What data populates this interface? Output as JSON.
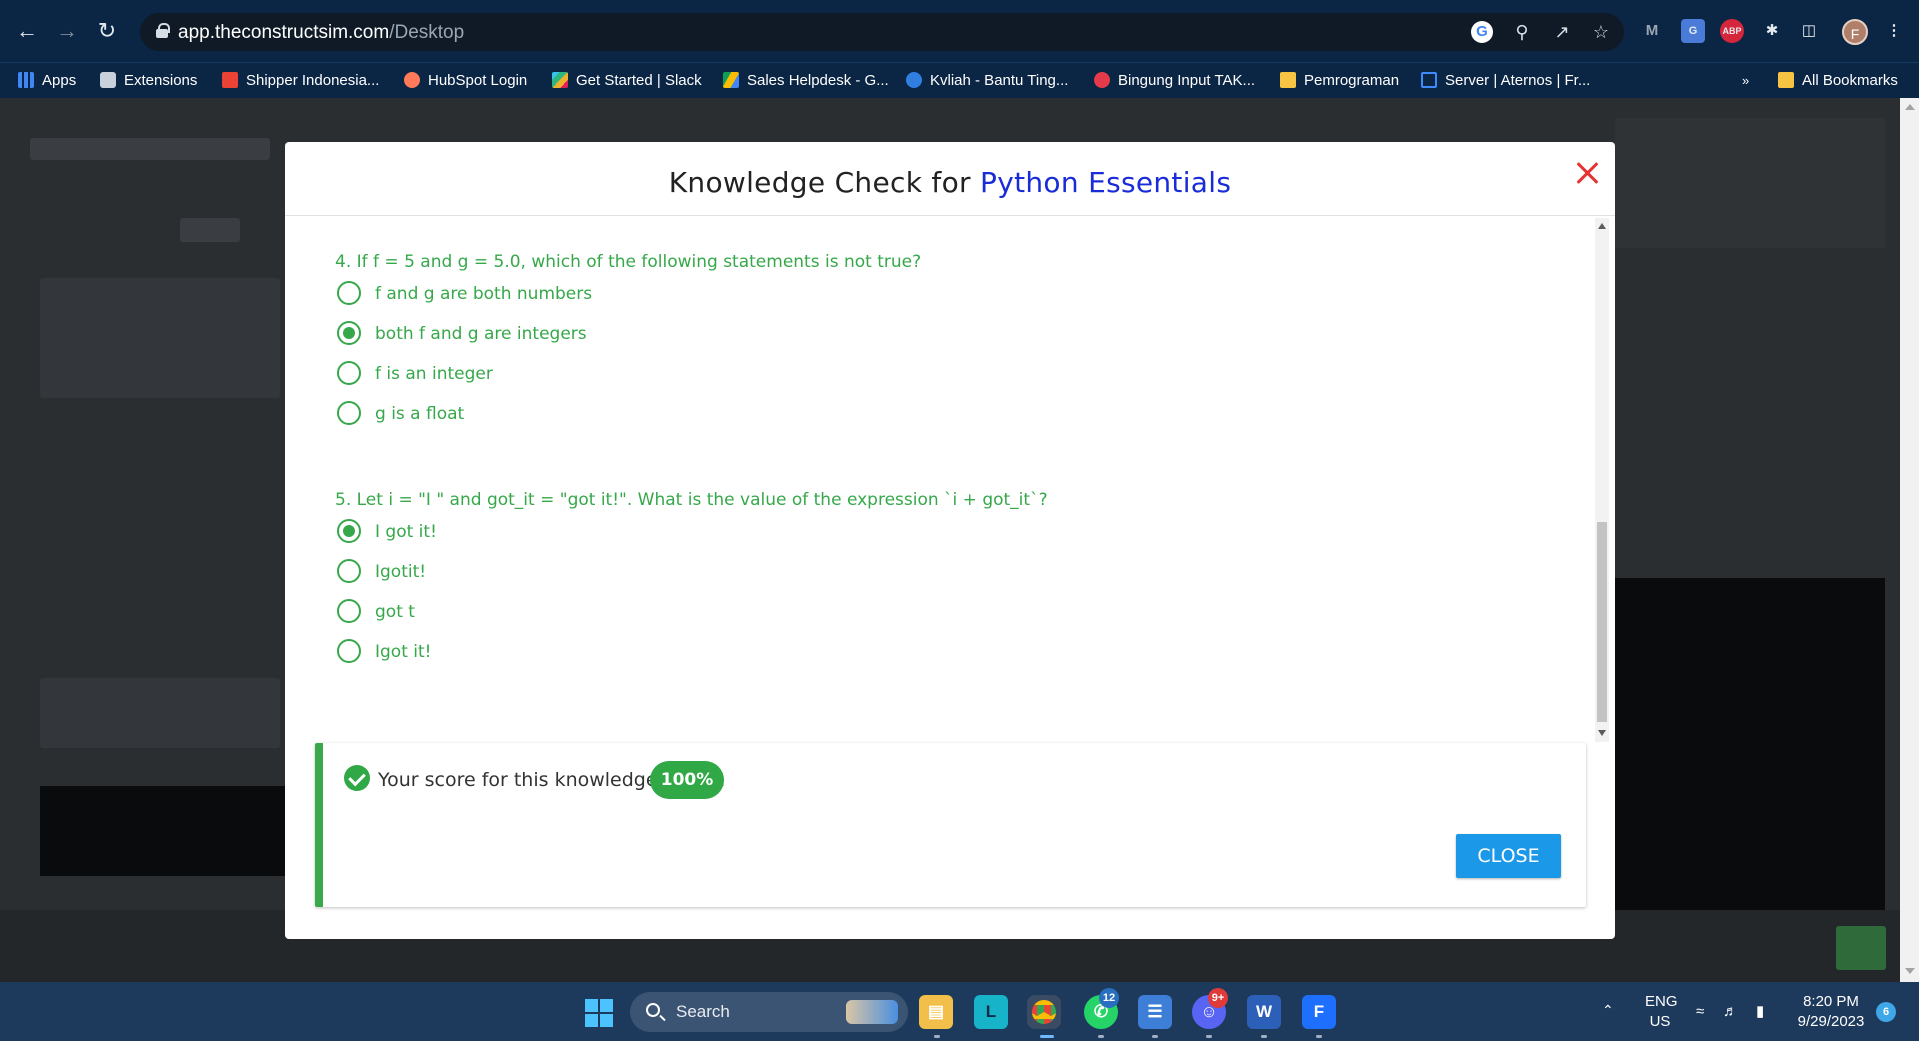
{
  "browser": {
    "url_host": "app.theconstructsim.com",
    "url_path": "/Desktop",
    "profile_initial": "F",
    "ext_abp": "ABP",
    "bookmarks": [
      {
        "label": "Apps",
        "icon": "apps-grid-icon",
        "color": "#4285f4"
      },
      {
        "label": "Extensions",
        "icon": "puzzle-icon",
        "color": "#e6eaef"
      },
      {
        "label": "Shipper Indonesia...",
        "icon": "gmail-icon",
        "color": "#ea4335"
      },
      {
        "label": "HubSpot Login",
        "icon": "hubspot-icon",
        "color": "#ff7a59"
      },
      {
        "label": "Get Started | Slack",
        "icon": "slack-icon",
        "color": "#36c5f0"
      },
      {
        "label": "Sales Helpdesk - G...",
        "icon": "google-drive-icon",
        "color": "#fbbc04"
      },
      {
        "label": "Kvliah - Bantu Ting...",
        "icon": "kvliah-icon",
        "color": "#2f7fe0"
      },
      {
        "label": "Bingung Input TAK...",
        "icon": "bingung-icon",
        "color": "#e53a4a"
      },
      {
        "label": "Pemrograman",
        "icon": "folder-icon",
        "color": "#f6c342"
      },
      {
        "label": "Server | Aternos | Fr...",
        "icon": "aternos-icon",
        "color": "#3d8bff"
      }
    ],
    "more_bookmarks": "»",
    "all_bookmarks": "All Bookmarks"
  },
  "modal": {
    "title_prefix": "Knowledge Check for ",
    "title_accent": "Python Essentials",
    "title_accent_color": "#1a2cd8",
    "questions": [
      {
        "text": "4. If f = 5 and g = 5.0, which of the following statements is not true?",
        "options": [
          {
            "label": "f and g are both numbers",
            "selected": false
          },
          {
            "label": "both f and g are integers",
            "selected": true
          },
          {
            "label": "f is an integer",
            "selected": false
          },
          {
            "label": "g is a float",
            "selected": false
          }
        ]
      },
      {
        "text": "5. Let i = \"I \" and got_it = \"got it!\". What is the value of the expression `i + got_it`?",
        "options": [
          {
            "label": "I got it!",
            "selected": true
          },
          {
            "label": "Igotit!",
            "selected": false
          },
          {
            "label": "got t",
            "selected": false
          },
          {
            "label": "Igot it!",
            "selected": false
          }
        ]
      }
    ],
    "score_label": "Your score for this knowledge check:",
    "score_value": "100%",
    "close_button": "CLOSE",
    "accent_green": "#36a84a",
    "close_button_color": "#1c98e8"
  },
  "taskbar": {
    "search_label": "Search",
    "chrome_badge": "12",
    "discord_badge": "9+",
    "language": "ENG",
    "region": "US",
    "time": "8:20 PM",
    "date": "9/29/2023",
    "notification_count": "6"
  }
}
